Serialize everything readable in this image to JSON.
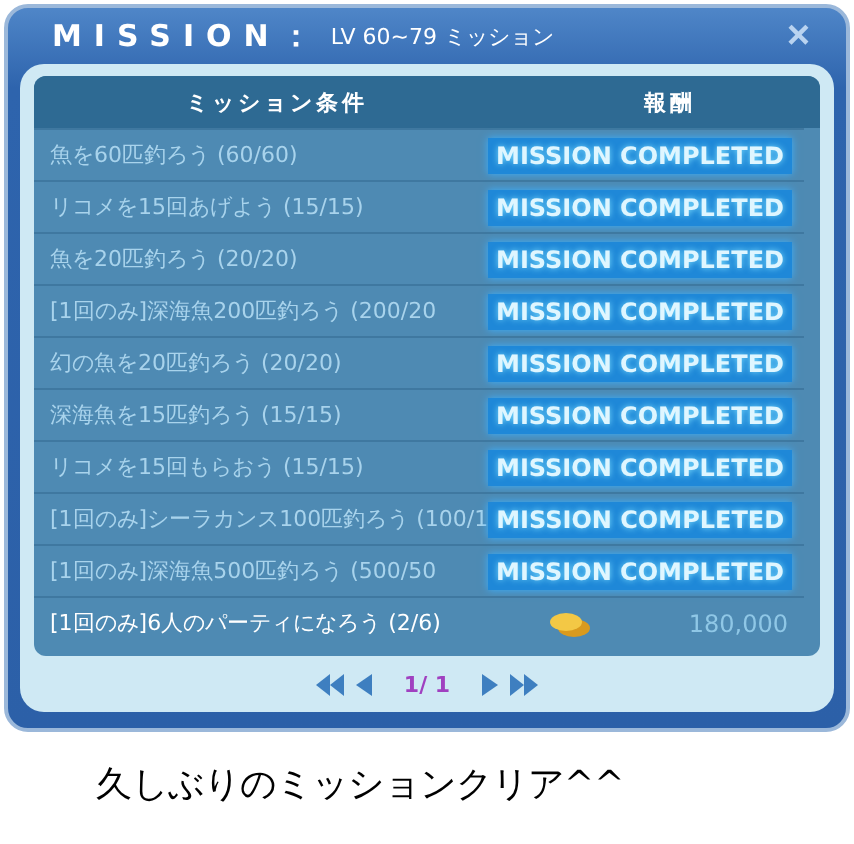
{
  "window": {
    "title": "MISSION：",
    "subtitle": "LV 60~79 ミッション",
    "close": "×"
  },
  "table": {
    "columns": [
      "ミッション条件",
      "報酬"
    ],
    "rows": [
      {
        "condition": "魚を60匹釣ろう (60/60)",
        "kind": "completed",
        "reward": "MISSION COMPLETED"
      },
      {
        "condition": "リコメを15回あげよう (15/15)",
        "kind": "completed",
        "reward": "MISSION COMPLETED"
      },
      {
        "condition": "魚を20匹釣ろう (20/20)",
        "kind": "completed",
        "reward": "MISSION COMPLETED"
      },
      {
        "condition": "[1回のみ]深海魚200匹釣ろう (200/20",
        "kind": "completed",
        "reward": "MISSION COMPLETED"
      },
      {
        "condition": "幻の魚を20匹釣ろう (20/20)",
        "kind": "completed",
        "reward": "MISSION COMPLETED"
      },
      {
        "condition": "深海魚を15匹釣ろう (15/15)",
        "kind": "completed",
        "reward": "MISSION COMPLETED"
      },
      {
        "condition": "リコメを15回もらおう (15/15)",
        "kind": "completed",
        "reward": "MISSION COMPLETED"
      },
      {
        "condition": "[1回のみ]シーラカンス100匹釣ろう (100/1",
        "kind": "completed",
        "reward": "MISSION COMPLETED"
      },
      {
        "condition": "[1回のみ]深海魚500匹釣ろう (500/50",
        "kind": "completed",
        "reward": "MISSION COMPLETED"
      },
      {
        "condition": "[1回のみ]6人のパーティになろう (2/6)",
        "kind": "coins",
        "reward": "180,000"
      }
    ]
  },
  "pager": {
    "page": "1/ 1"
  },
  "caption": "久しぶりのミッションクリア^^"
}
